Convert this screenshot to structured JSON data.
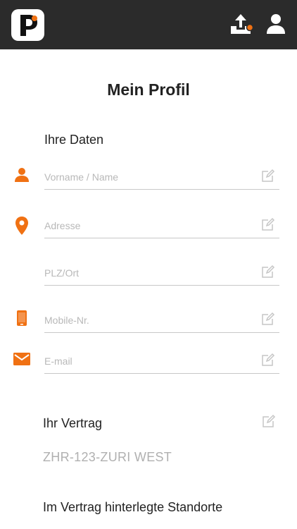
{
  "app": {
    "logo_letter": "P",
    "brand_color": "#f07113",
    "topbar_color": "#2b2b2b"
  },
  "header": {
    "icons": [
      "logo-icon",
      "upload-icon",
      "user-icon"
    ]
  },
  "page": {
    "title": "Mein Profil",
    "section_data": "Ihre Daten",
    "fields": {
      "name": {
        "placeholder": "Vorname / Name",
        "value": ""
      },
      "address": {
        "placeholder": "Adresse",
        "value": ""
      },
      "zip_city": {
        "placeholder": "PLZ/Ort",
        "value": ""
      },
      "mobile": {
        "placeholder": "Mobile-Nr.",
        "value": ""
      },
      "email": {
        "placeholder": "E-mail",
        "value": ""
      }
    },
    "section_contract": "Ihr Vertrag",
    "contract_value": "ZHR-123-ZURI WEST",
    "section_locations": "Im Vertrag hinterlegte Standorte"
  }
}
